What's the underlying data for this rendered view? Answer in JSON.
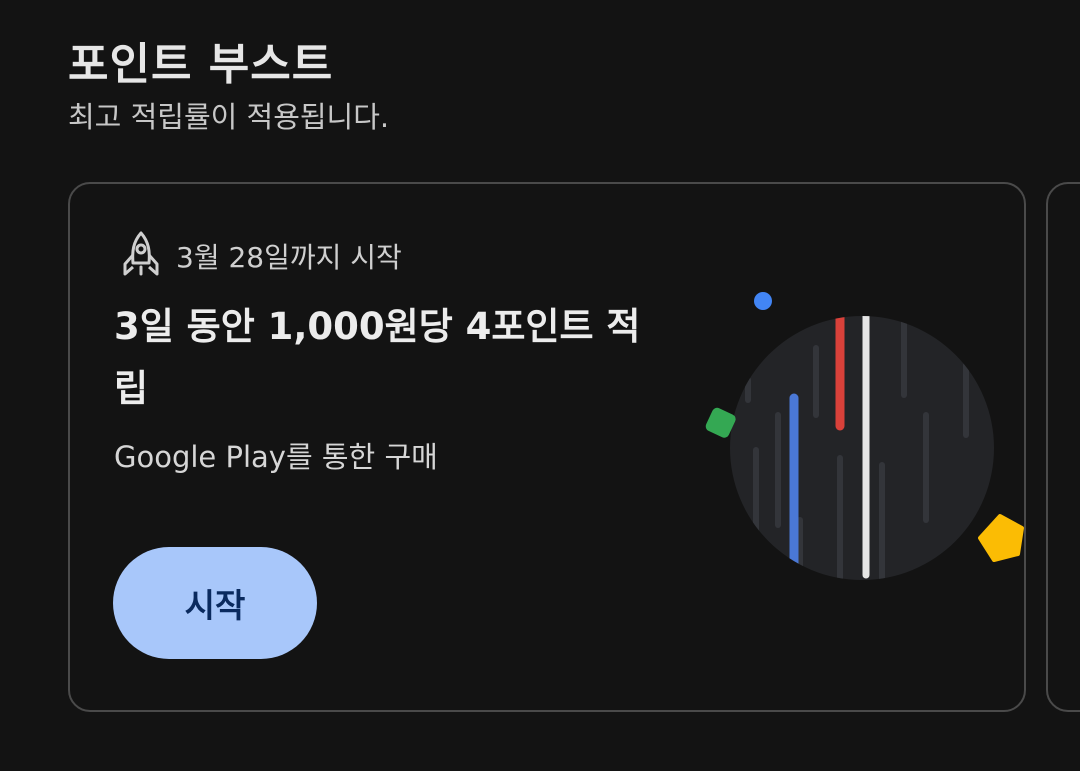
{
  "section": {
    "title": "포인트 부스트",
    "subtitle": "최고 적립률이 적용됩니다."
  },
  "offer_card": {
    "icon": "rocket-icon",
    "deadline": "3월 28일까지 시작",
    "title": "3일 동안 1,000원당 4포인트 적립",
    "description": "Google Play를 통한 구매",
    "button_label": "시작"
  },
  "colors": {
    "background": "#131313",
    "button": "#a8c7fa",
    "button_text": "#0a2a5e",
    "google_blue": "#4285f4",
    "google_red": "#d93025",
    "google_green": "#34a853",
    "google_yellow": "#fbbc04"
  }
}
